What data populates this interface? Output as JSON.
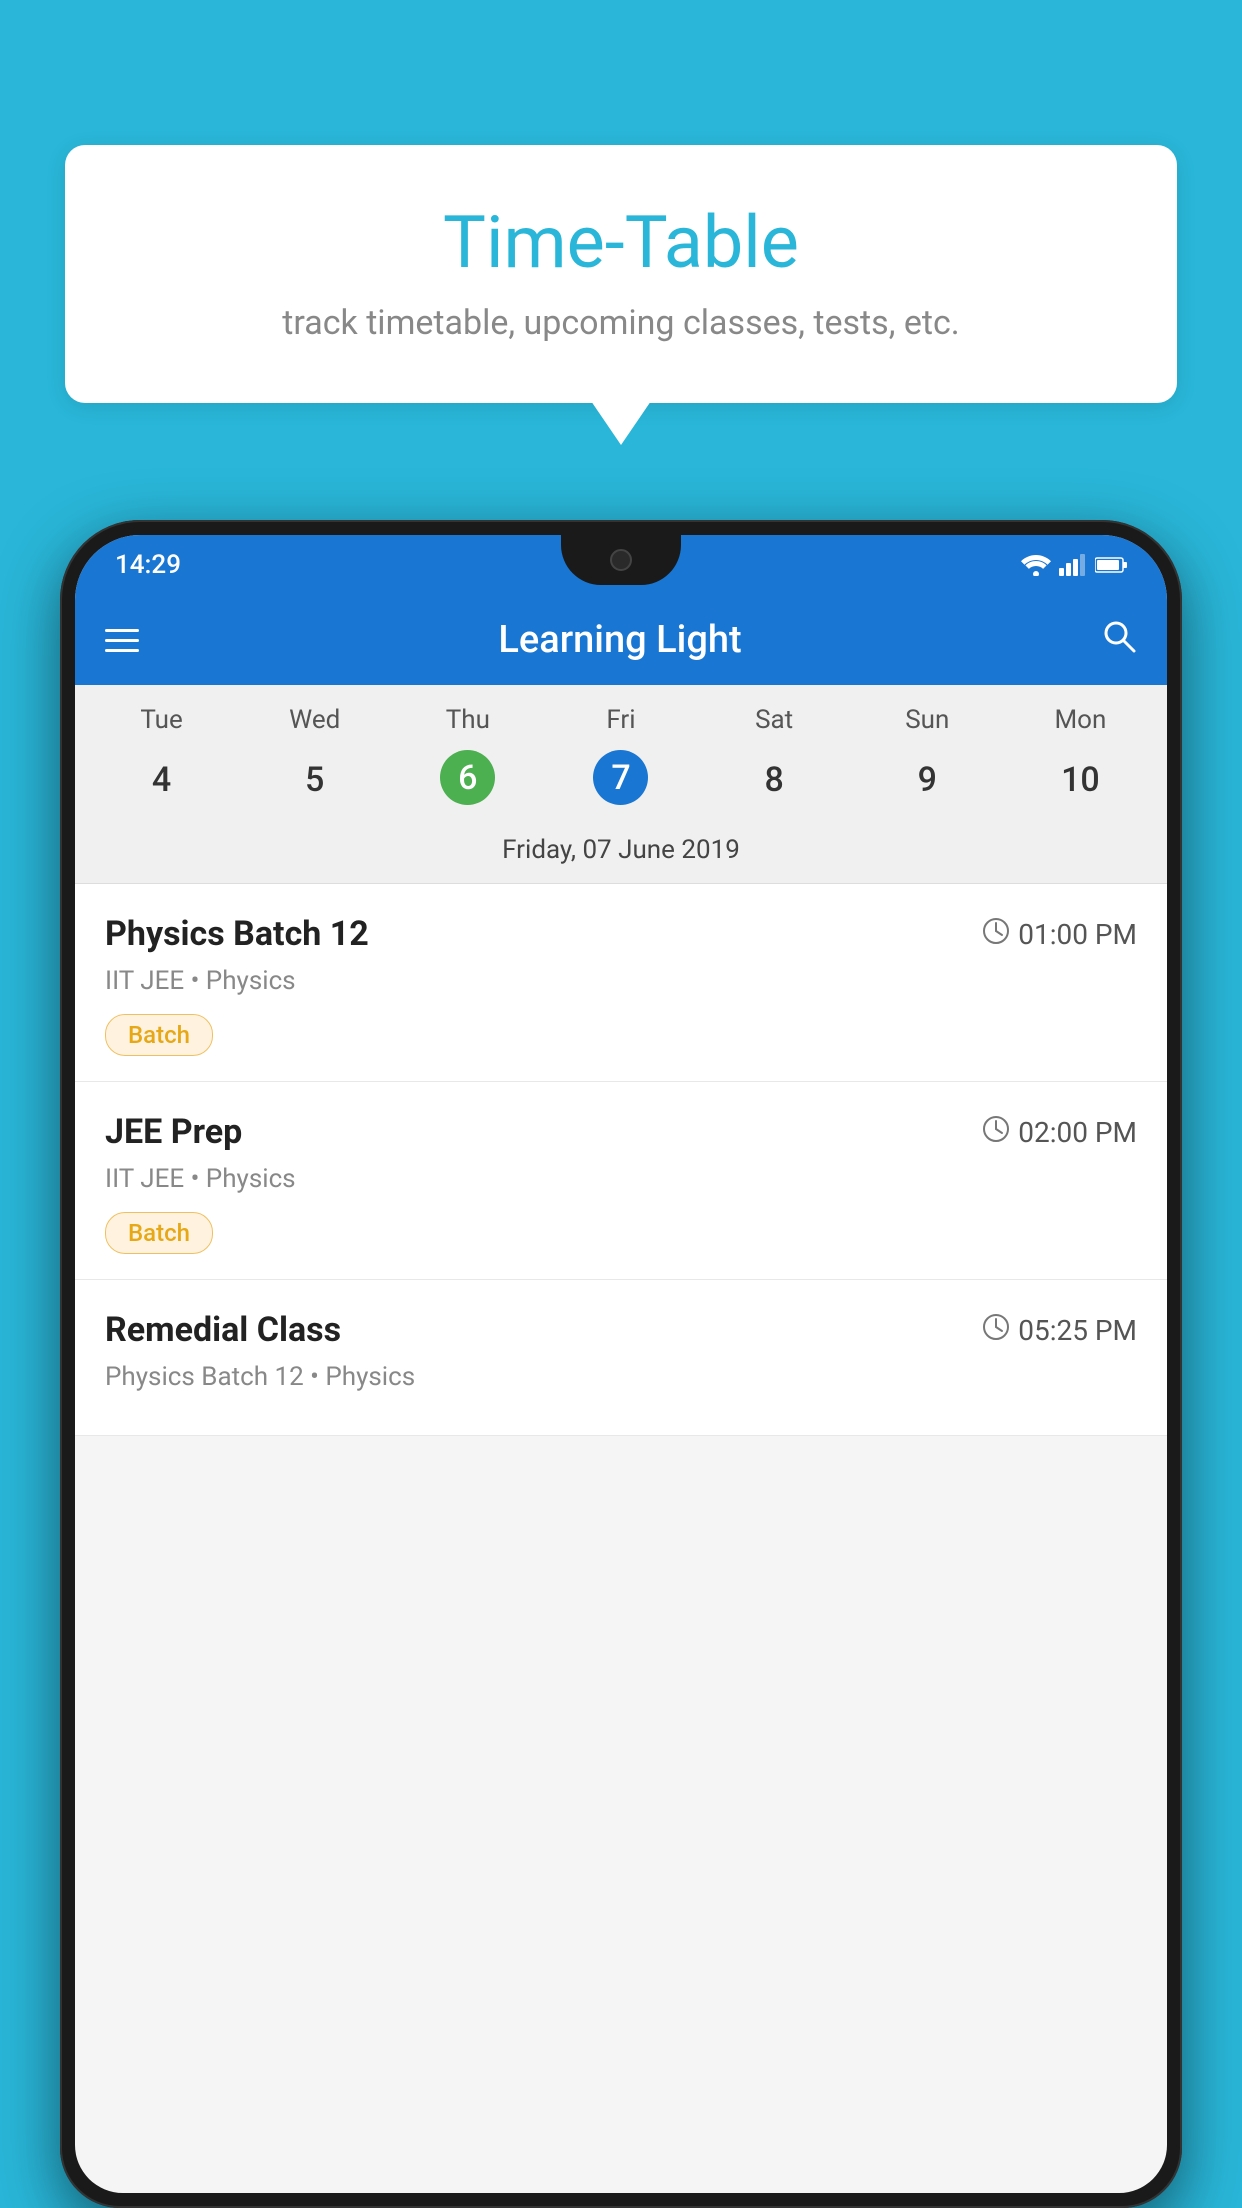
{
  "background_color": "#29B6D8",
  "bubble": {
    "title": "Time-Table",
    "subtitle": "track timetable, upcoming classes, tests, etc."
  },
  "phone": {
    "status_bar": {
      "time": "14:29",
      "icons": [
        "wifi",
        "signal",
        "battery"
      ]
    },
    "app_bar": {
      "title": "Learning Light",
      "has_hamburger": true,
      "has_search": true
    },
    "calendar": {
      "days": [
        {
          "label": "Tue",
          "number": "4"
        },
        {
          "label": "Wed",
          "number": "5"
        },
        {
          "label": "Thu",
          "number": "6",
          "state": "today"
        },
        {
          "label": "Fri",
          "number": "7",
          "state": "selected"
        },
        {
          "label": "Sat",
          "number": "8"
        },
        {
          "label": "Sun",
          "number": "9"
        },
        {
          "label": "Mon",
          "number": "10"
        }
      ],
      "selected_date_label": "Friday, 07 June 2019"
    },
    "schedule": [
      {
        "title": "Physics Batch 12",
        "time": "01:00 PM",
        "subtitle": "IIT JEE • Physics",
        "tag": "Batch"
      },
      {
        "title": "JEE Prep",
        "time": "02:00 PM",
        "subtitle": "IIT JEE • Physics",
        "tag": "Batch"
      },
      {
        "title": "Remedial Class",
        "time": "05:25 PM",
        "subtitle": "Physics Batch 12 • Physics",
        "tag": null
      }
    ]
  }
}
